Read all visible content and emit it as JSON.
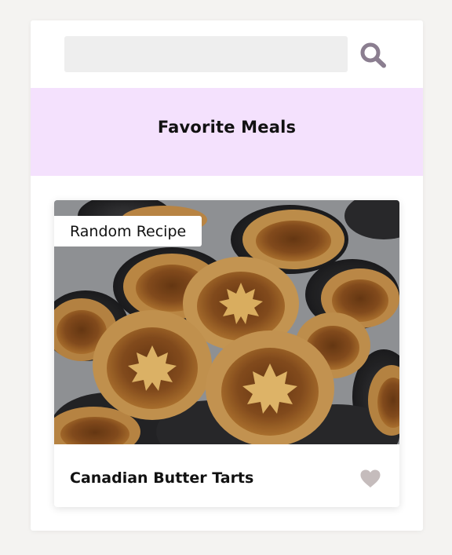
{
  "search": {
    "value": "",
    "placeholder": "",
    "icon": "search-icon"
  },
  "favorites": {
    "title": "Favorite Meals"
  },
  "meal": {
    "tag": "Random Recipe",
    "name": "Canadian Butter Tarts",
    "image": "butter-tarts-photo",
    "favorite_icon": "heart-icon"
  },
  "colors": {
    "page_bg": "#f4f3f1",
    "card_bg": "#ffffff",
    "search_bg": "#eeeeee",
    "search_icon": "#8b7e90",
    "favorites_bg": "#f4e1fd",
    "heart_inactive": "#c5bcbc",
    "text": "#111111"
  }
}
